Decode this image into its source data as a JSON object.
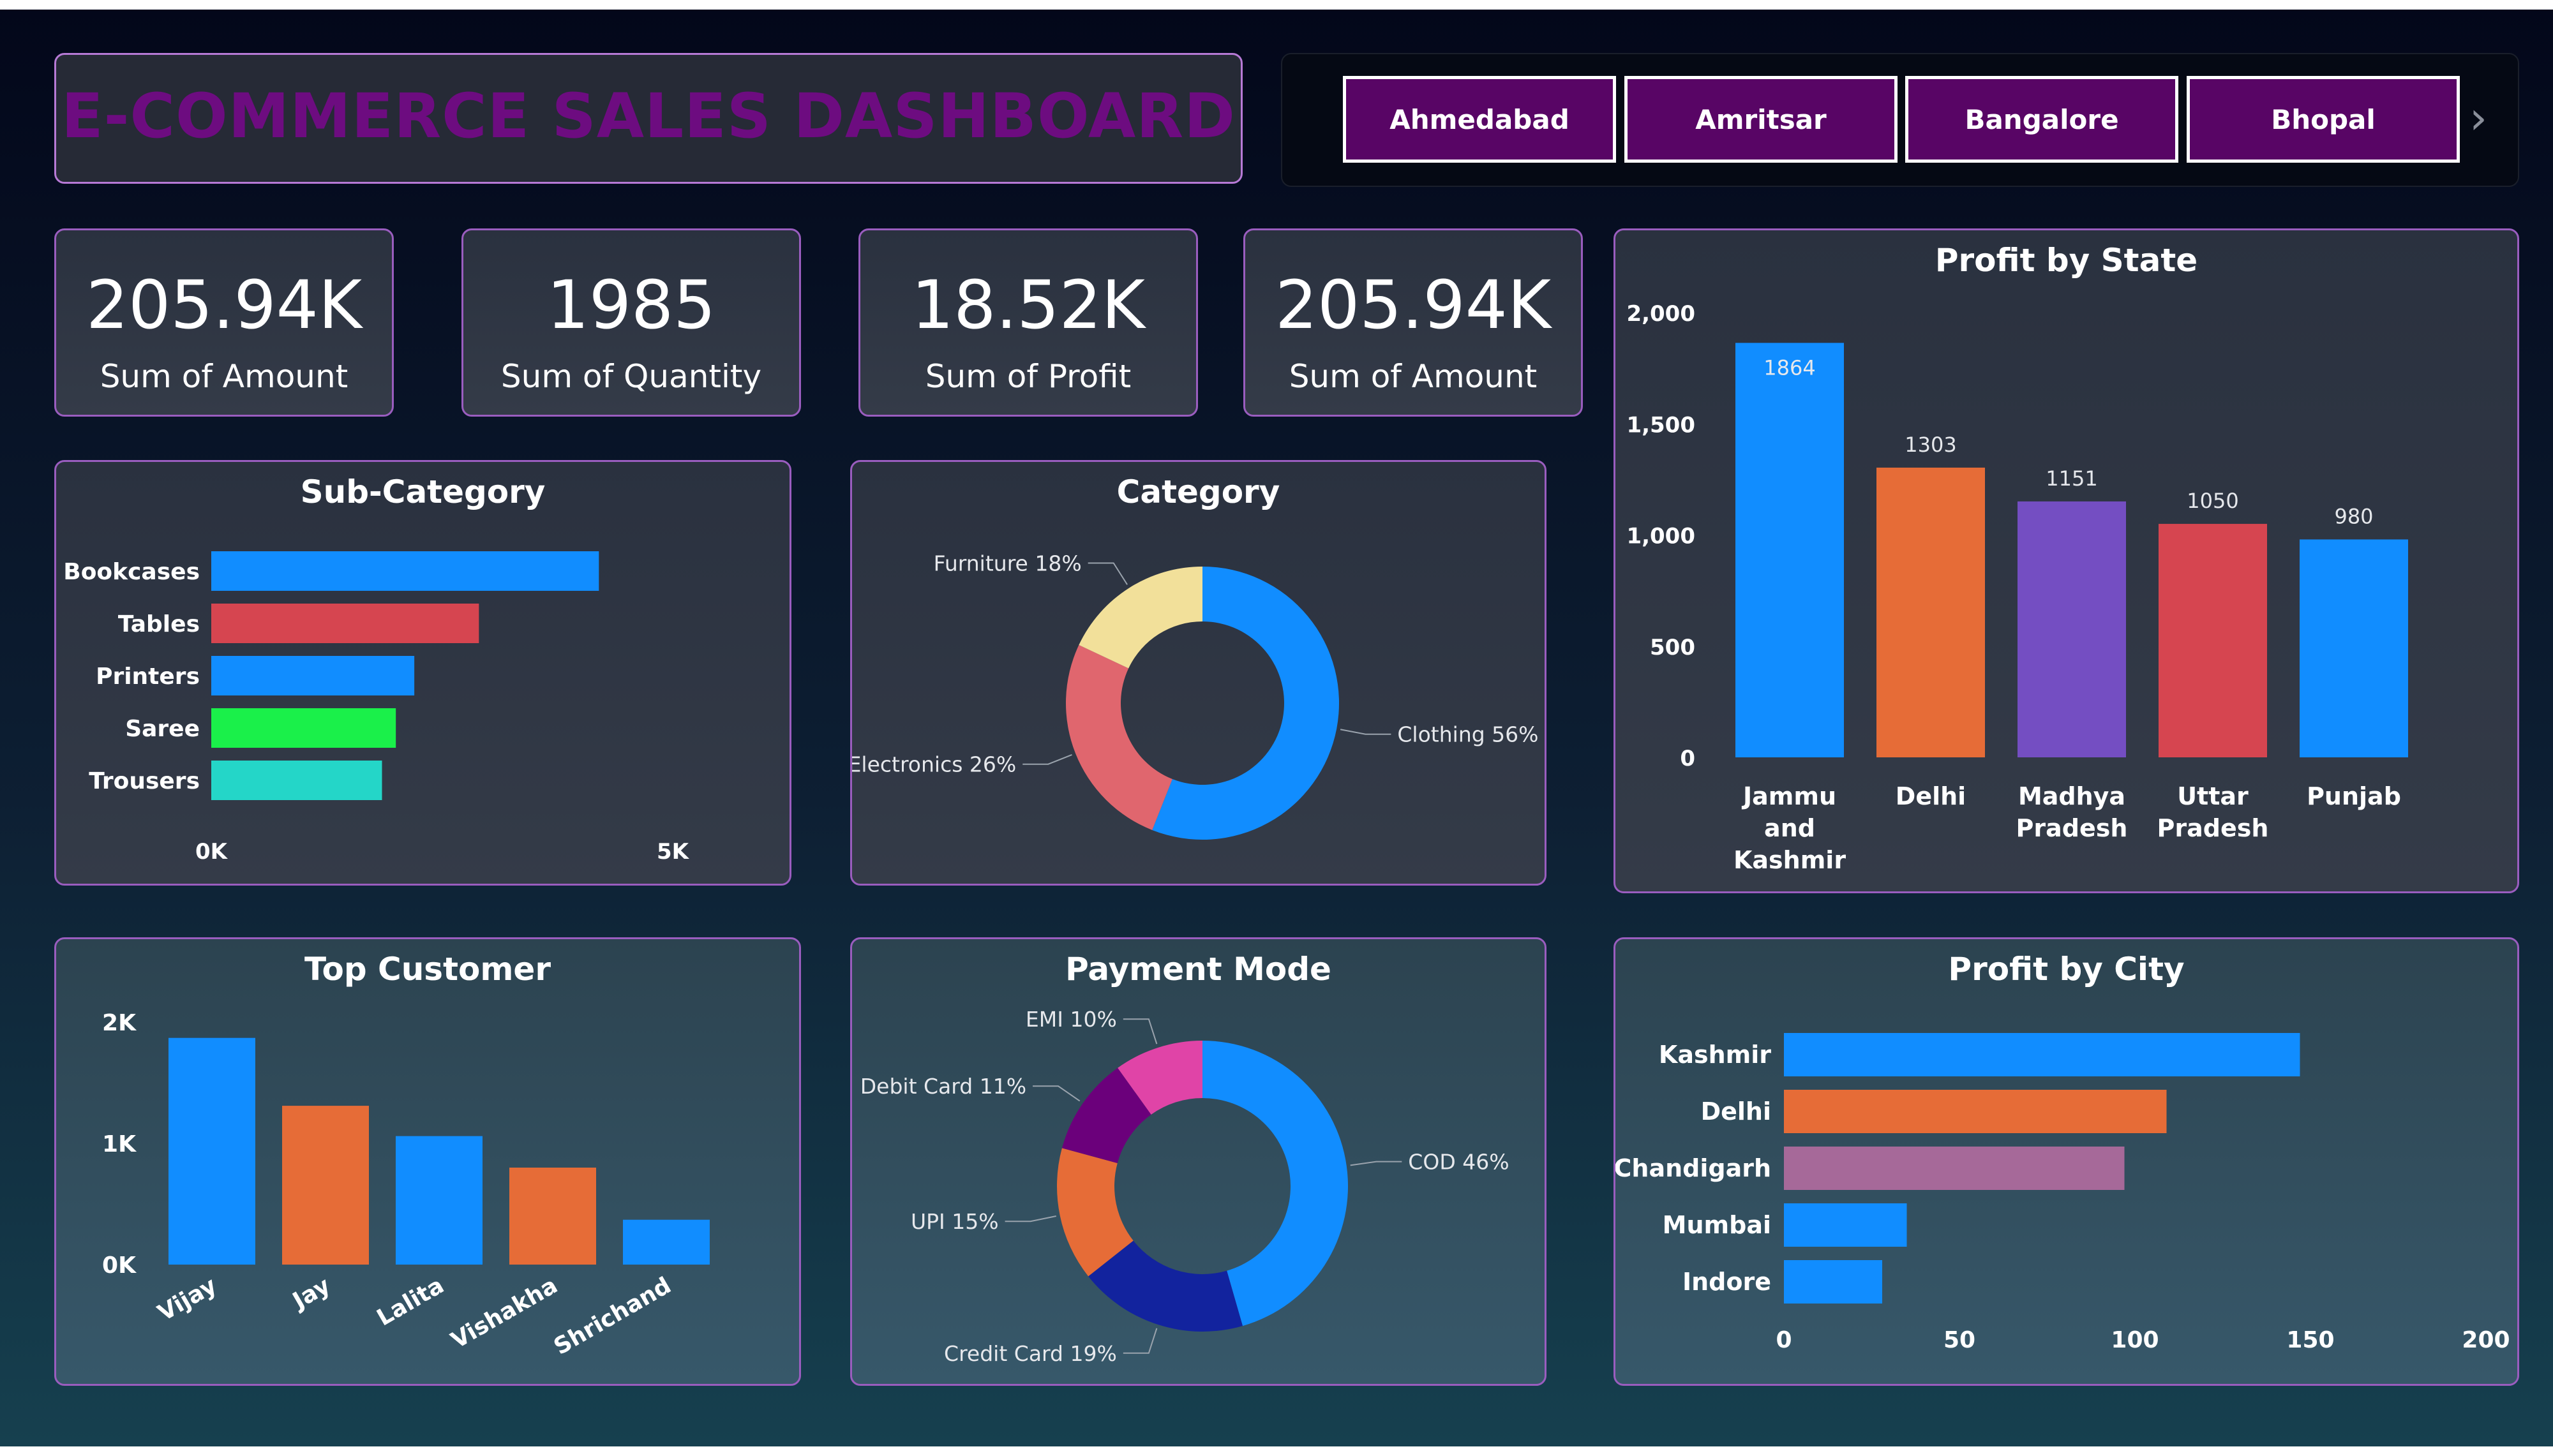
{
  "dashboard_title": "E-COMMERCE SALES DASHBOARD",
  "city_slicer": [
    "Ahmedabad",
    "Amritsar",
    "Bangalore",
    "Bhopal"
  ],
  "kpis": [
    {
      "value": "205.94K",
      "label": "Sum of Amount"
    },
    {
      "value": "1985",
      "label": "Sum of Quantity"
    },
    {
      "value": "18.52K",
      "label": "Sum of Profit"
    },
    {
      "value": "205.94K",
      "label": "Sum of Amount"
    }
  ],
  "panels": {
    "sub_category": "Sub-Category",
    "category": "Category",
    "profit_by_state": "Profit by State",
    "top_customer": "Top Customer",
    "payment_mode": "Payment Mode",
    "profit_by_city": "Profit by City"
  },
  "chart_data": [
    {
      "id": "sub_category",
      "type": "bar",
      "orientation": "horizontal",
      "title": "Sub-Category",
      "categories": [
        "Bookcases",
        "Tables",
        "Printers",
        "Saree",
        "Trousers"
      ],
      "values": [
        4200,
        2900,
        2200,
        2000,
        1850
      ],
      "colors": [
        "#118DFF",
        "#D64550",
        "#118DFF",
        "#1AF04A",
        "#24D6C8"
      ],
      "xlim": [
        0,
        5000
      ],
      "tick_labels": [
        "0K",
        "5K"
      ]
    },
    {
      "id": "category",
      "type": "pie",
      "donut": true,
      "title": "Category",
      "labels": [
        "Clothing",
        "Electronics",
        "Furniture"
      ],
      "values": [
        56,
        26,
        18
      ],
      "colors": [
        "#118DFF",
        "#E0666E",
        "#F2E09A"
      ],
      "data_labels": [
        "Clothing 56%",
        "Electronics 26%",
        "Furniture 18%"
      ]
    },
    {
      "id": "profit_by_state",
      "type": "bar",
      "title": "Profit by State",
      "categories": [
        "Jammu and Kashmir",
        "Delhi",
        "Madhya Pradesh",
        "Uttar Pradesh",
        "Punjab"
      ],
      "values": [
        1864,
        1303,
        1151,
        1050,
        980
      ],
      "colors": [
        "#118DFF",
        "#E66C37",
        "#744EC2",
        "#D64550",
        "#118DFF"
      ],
      "ylim": [
        0,
        2000
      ],
      "yticks": [
        0,
        500,
        1000,
        1500,
        2000
      ],
      "ytick_labels": [
        "0",
        "500",
        "1,000",
        "1,500",
        "2,000"
      ]
    },
    {
      "id": "top_customer",
      "type": "bar",
      "title": "Top Customer",
      "categories": [
        "Vijay",
        "Jay",
        "Lalita",
        "Vishakha",
        "Shrichand"
      ],
      "values": [
        1870,
        1310,
        1060,
        800,
        370
      ],
      "colors": [
        "#118DFF",
        "#E66C37",
        "#118DFF",
        "#E66C37",
        "#118DFF"
      ],
      "ylim": [
        0,
        2000
      ],
      "yticks": [
        0,
        1000,
        2000
      ],
      "ytick_labels": [
        "0K",
        "1K",
        "2K"
      ]
    },
    {
      "id": "payment_mode",
      "type": "pie",
      "donut": true,
      "title": "Payment Mode",
      "labels": [
        "COD",
        "Credit Card",
        "UPI",
        "Debit Card",
        "EMI"
      ],
      "values": [
        46,
        19,
        15,
        11,
        10
      ],
      "colors": [
        "#118DFF",
        "#12239E",
        "#E66C37",
        "#6B007B",
        "#E044A7"
      ],
      "data_labels": [
        "COD 46%",
        "Credit Card 19%",
        "UPI 15%",
        "Debit Card 11%",
        "EMI 10%"
      ]
    },
    {
      "id": "profit_by_city",
      "type": "bar",
      "orientation": "horizontal",
      "title": "Profit by City",
      "categories": [
        "Kashmir",
        "Delhi",
        "Chandigarh",
        "Mumbai",
        "Indore"
      ],
      "values": [
        147,
        109,
        97,
        35,
        28
      ],
      "colors": [
        "#118DFF",
        "#E66C37",
        "#A66999",
        "#118DFF",
        "#118DFF"
      ],
      "xlim": [
        0,
        200
      ],
      "xticks": [
        0,
        50,
        100,
        150,
        200
      ],
      "tick_labels": [
        "0",
        "50",
        "100",
        "150",
        "200"
      ]
    }
  ]
}
